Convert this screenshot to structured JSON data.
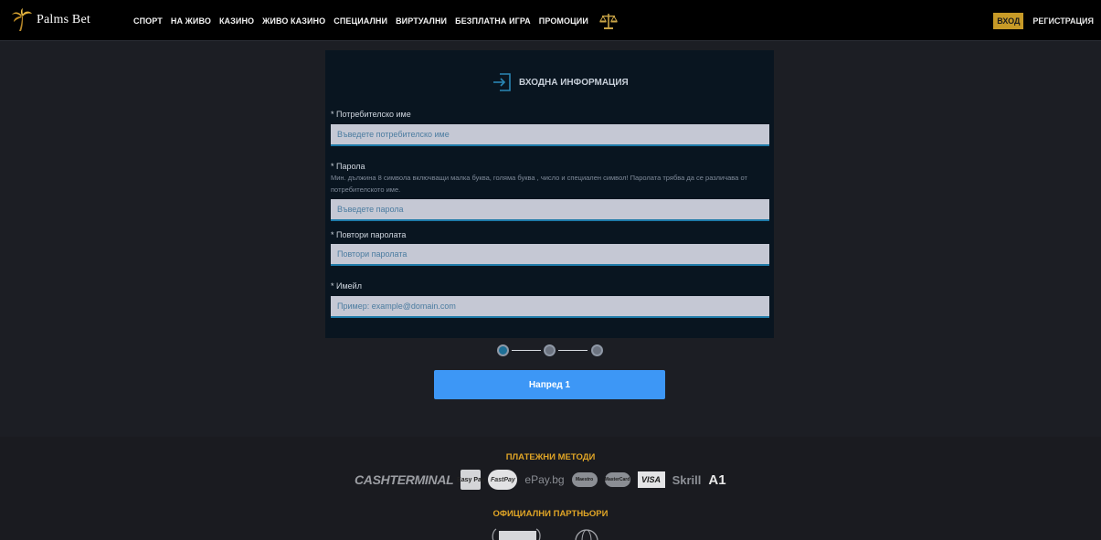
{
  "header": {
    "logo_text": "Palms Bet",
    "nav": [
      "СПОРТ",
      "НА ЖИВО",
      "КАЗИНО",
      "ЖИВО КАЗИНО",
      "СПЕЦИАЛНИ",
      "ВИРТУАЛНИ",
      "БЕЗПЛАТНА ИГРА",
      "ПРОМОЦИИ"
    ],
    "login_label": "ВХОД",
    "register_label": "РЕГИСТРАЦИЯ"
  },
  "form": {
    "title": "ВХОДНА ИНФОРМАЦИЯ",
    "username": {
      "label": "* Потребителско име",
      "placeholder": "Въведете потребителско име",
      "value": ""
    },
    "password": {
      "label": "* Парола",
      "hint": "Мин. дължина 8 символа включващи малка буква, голяма буква , число и специален символ! Паролата трябва да се различава от потребителското име.",
      "placeholder": "Въведете парола",
      "value": ""
    },
    "repeat_password": {
      "label": "* Повтори паролата",
      "placeholder": "Повтори паролата",
      "value": ""
    },
    "email": {
      "label": "* Имейл",
      "placeholder": "Пример: example@domain.com",
      "value": ""
    }
  },
  "stepper": {
    "current_step": 1,
    "total_steps": 3
  },
  "next_button_label": "Напред 1",
  "footer": {
    "payments_heading": "ПЛАТЕЖНИ МЕТОДИ",
    "payment_methods": [
      "CASHTERMINAL",
      "Easy Pay",
      "FastPay",
      "ePay.bg",
      "Maestro",
      "MasterCard",
      "VISA",
      "Skrill",
      "A1"
    ],
    "partners_heading": "ОФИЦИАЛНИ ПАРТНЬОРИ"
  },
  "colors": {
    "accent_gold": "#c79a27",
    "primary_blue": "#3d97f6",
    "card_bg": "#091520",
    "step_active": "#1e6f96"
  }
}
